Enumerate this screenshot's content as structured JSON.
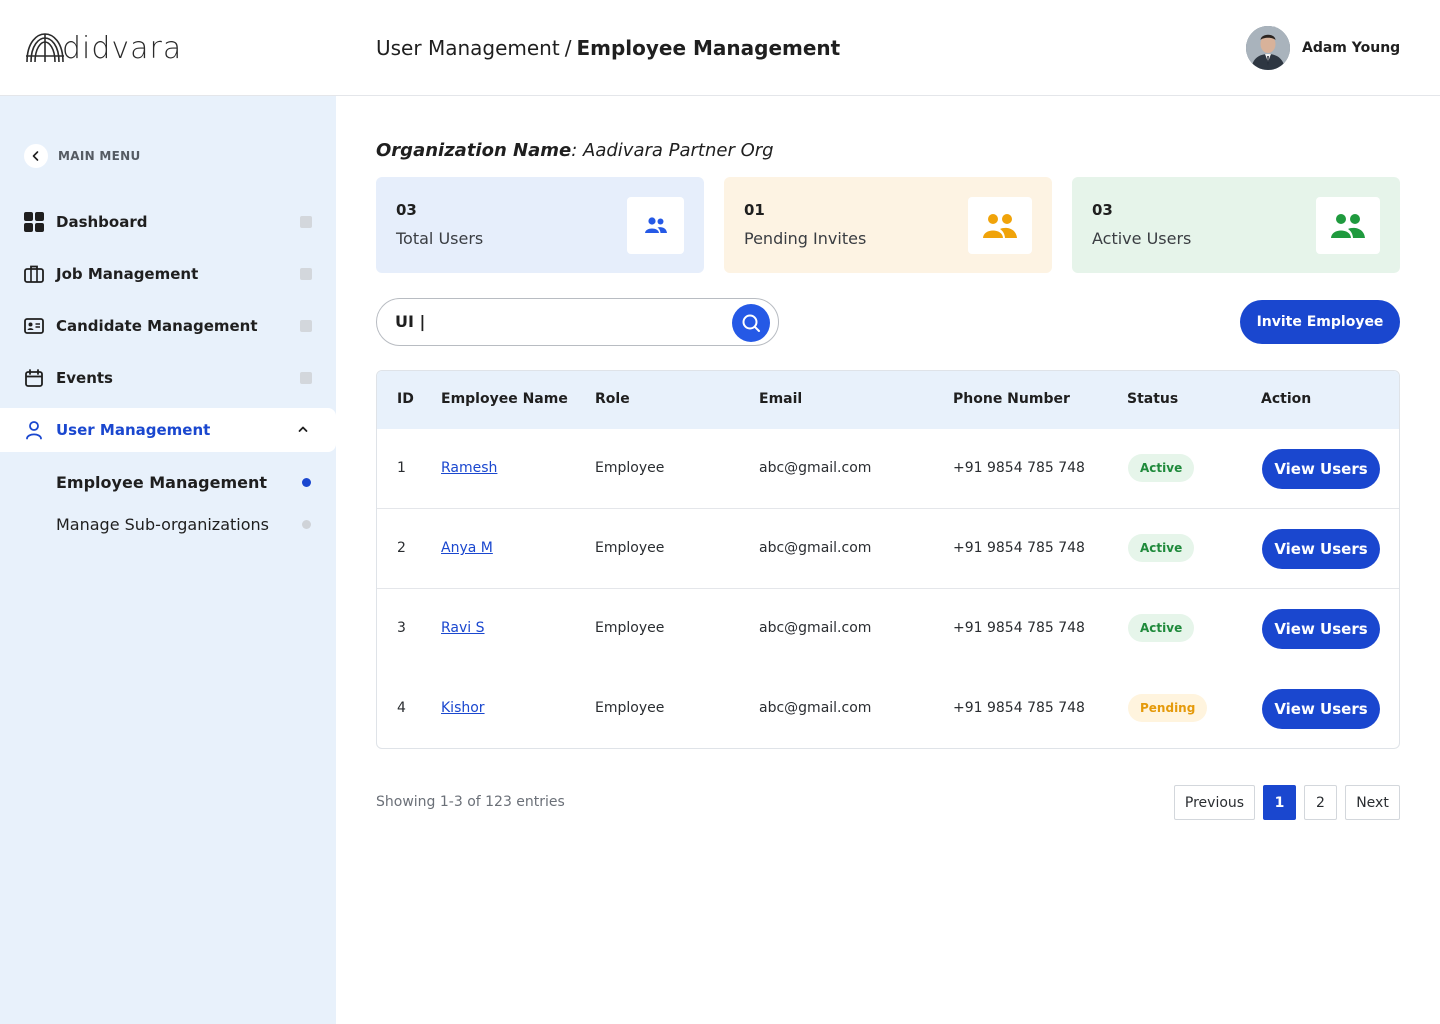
{
  "app": {
    "logo_text": "didvara",
    "logo_icon": "arch-logo-icon"
  },
  "header": {
    "breadcrumb_parent": "User Management",
    "breadcrumb_separator": "/",
    "breadcrumb_current": "Employee Management",
    "user_name": "Adam Young",
    "avatar_icon": "user-avatar"
  },
  "sidebar": {
    "main_menu_label": "MAIN MENU",
    "items": [
      {
        "label": "Dashboard",
        "icon": "grid-icon"
      },
      {
        "label": "Job Management",
        "icon": "briefcase-icon"
      },
      {
        "label": "Candidate Management",
        "icon": "id-card-icon"
      },
      {
        "label": "Events",
        "icon": "calendar-icon"
      },
      {
        "label": "User Management",
        "icon": "user-icon",
        "expanded": true
      }
    ],
    "sub_items": [
      {
        "label": "Employee Management",
        "selected": true
      },
      {
        "label": "Manage Sub-organizations",
        "selected": false
      }
    ]
  },
  "org": {
    "key": "Organization Name",
    "colon": ":",
    "value": "Aadivara Partner Org"
  },
  "stats": [
    {
      "value": "03",
      "label": "Total Users",
      "bg": "#e6eefb",
      "icon_color": "#2559e6",
      "icon": "users-icon"
    },
    {
      "value": "01",
      "label": "Pending Invites",
      "bg": "#fdf3e3",
      "icon_color": "#f0a30a",
      "icon": "users-icon"
    },
    {
      "value": "03",
      "label": "Active Users",
      "bg": "#e6f4ea",
      "icon_color": "#1f9a3e",
      "icon": "users-icon"
    }
  ],
  "search": {
    "value": "UI |",
    "icon": "search-icon"
  },
  "invite_button": "Invite Employee",
  "table": {
    "columns": [
      "ID",
      "Employee Name",
      "Role",
      "Email",
      "Phone Number",
      "Status",
      "Action"
    ],
    "rows": [
      {
        "id": "1",
        "name": "Ramesh",
        "role": "Employee",
        "email": "abc@gmail.com",
        "phone": "+91 9854 785 748",
        "status": "Active",
        "action": "View Users"
      },
      {
        "id": "2",
        "name": "Anya M",
        "role": "Employee",
        "email": "abc@gmail.com",
        "phone": "+91 9854 785 748",
        "status": "Active",
        "action": "View Users"
      },
      {
        "id": "3",
        "name": "Ravi S",
        "role": "Employee",
        "email": "abc@gmail.com",
        "phone": "+91 9854 785 748",
        "status": "Active",
        "action": "View Users"
      },
      {
        "id": "4",
        "name": "Kishor",
        "role": "Employee",
        "email": "abc@gmail.com",
        "phone": "+91 9854 785 748",
        "status": "Pending",
        "action": "View Users"
      }
    ]
  },
  "pagination": {
    "showing": "Showing 1-3 of 123 entries",
    "previous": "Previous",
    "pages": [
      "1",
      "2"
    ],
    "current": "1",
    "next": "Next"
  },
  "colors": {
    "accent": "#1a47cf",
    "sidebar_bg": "#e8f1fb",
    "active_badge_bg": "#e6f5ea",
    "active_badge_text": "#1f8a3b",
    "pending_badge_bg": "#fff4de",
    "pending_badge_text": "#e59a0b"
  }
}
